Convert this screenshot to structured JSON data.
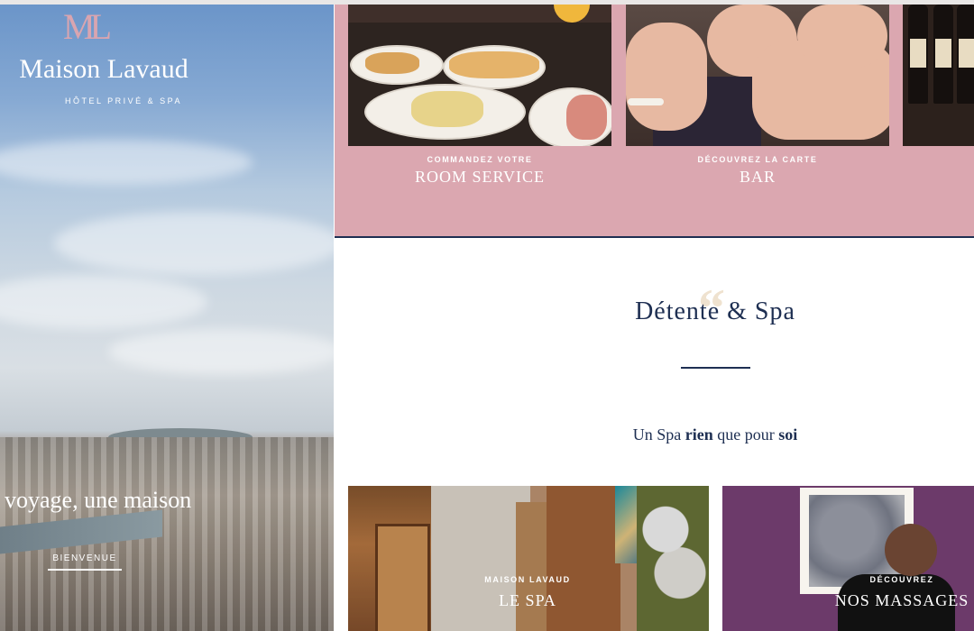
{
  "brand": {
    "logo_mark": "ML",
    "name": "Maison Lavaud",
    "tagline": "HÔTEL PRIVÉ & SPA"
  },
  "hero": {
    "headline": "voyage, une maison",
    "button": "BIENVENUE"
  },
  "cards": [
    {
      "kicker": "COMMANDEZ VOTRE",
      "title": "ROOM SERVICE"
    },
    {
      "kicker": "DÉCOUVREZ LA CARTE",
      "title": "BAR"
    }
  ],
  "spa_section": {
    "title": "Détente & Spa",
    "subtitle_pre": "Un Spa ",
    "subtitle_bold1": "rien",
    "subtitle_mid": " que pour ",
    "subtitle_bold2": "soi",
    "cards": [
      {
        "kicker": "MAISON LAVAUD",
        "title": "LE SPA"
      },
      {
        "kicker": "DÉCOUVREZ",
        "title": "NOS MASSAGES"
      }
    ]
  },
  "colors": {
    "accent_pink": "#dba7b0",
    "navy": "#1e2f52",
    "logo_pink": "#d9a5b0"
  }
}
